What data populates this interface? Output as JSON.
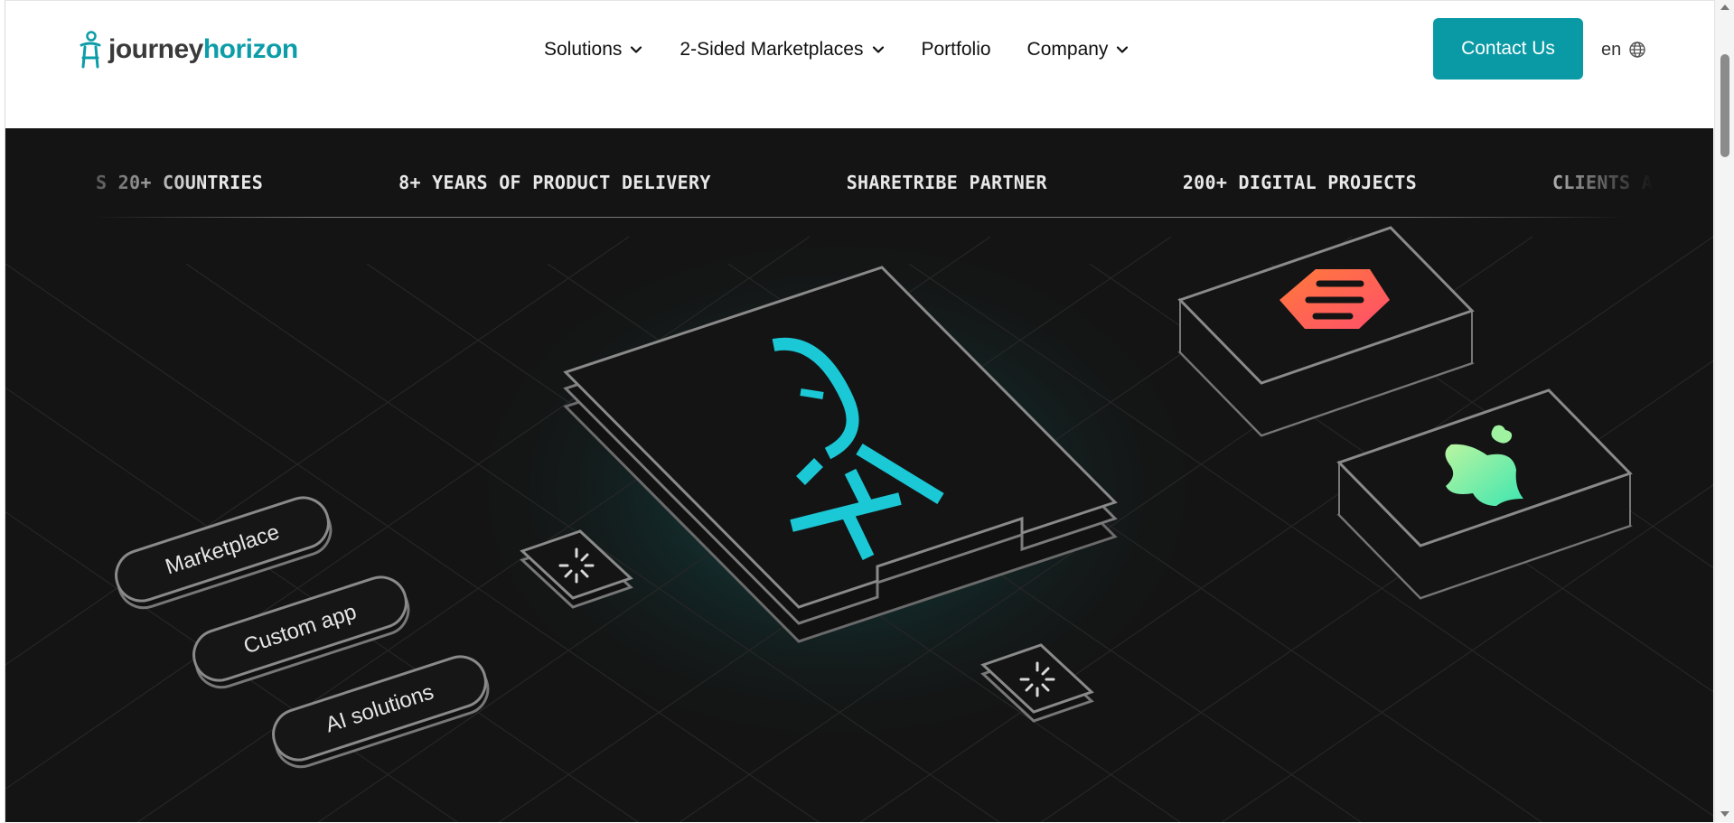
{
  "header": {
    "logo": {
      "word1": "journey",
      "word2": "horizon"
    },
    "nav": [
      {
        "label": "Solutions",
        "has_dropdown": true
      },
      {
        "label": "2-Sided Marketplaces",
        "has_dropdown": true
      },
      {
        "label": "Portfolio",
        "has_dropdown": false
      },
      {
        "label": "Company",
        "has_dropdown": true
      }
    ],
    "cta_label": "Contact Us",
    "language": "en"
  },
  "hero": {
    "ticker": [
      "S 20+ COUNTRIES",
      "8+ YEARS OF PRODUCT DELIVERY",
      "SHARETRIBE PARTNER",
      "200+ DIGITAL PROJECTS",
      "CLIENTS ACROS"
    ],
    "pills": [
      "Marketplace",
      "Custom app",
      "AI solutions"
    ]
  },
  "colors": {
    "accent": "#0a9aa6",
    "hero_bg": "#141414",
    "logo_cyan": "#1bc8d6",
    "orange": "#ff6a3d",
    "green": "#7ef0a8"
  },
  "icons": [
    "chevron-down-icon",
    "globe-icon",
    "loading-icon",
    "logo-mark-icon"
  ]
}
